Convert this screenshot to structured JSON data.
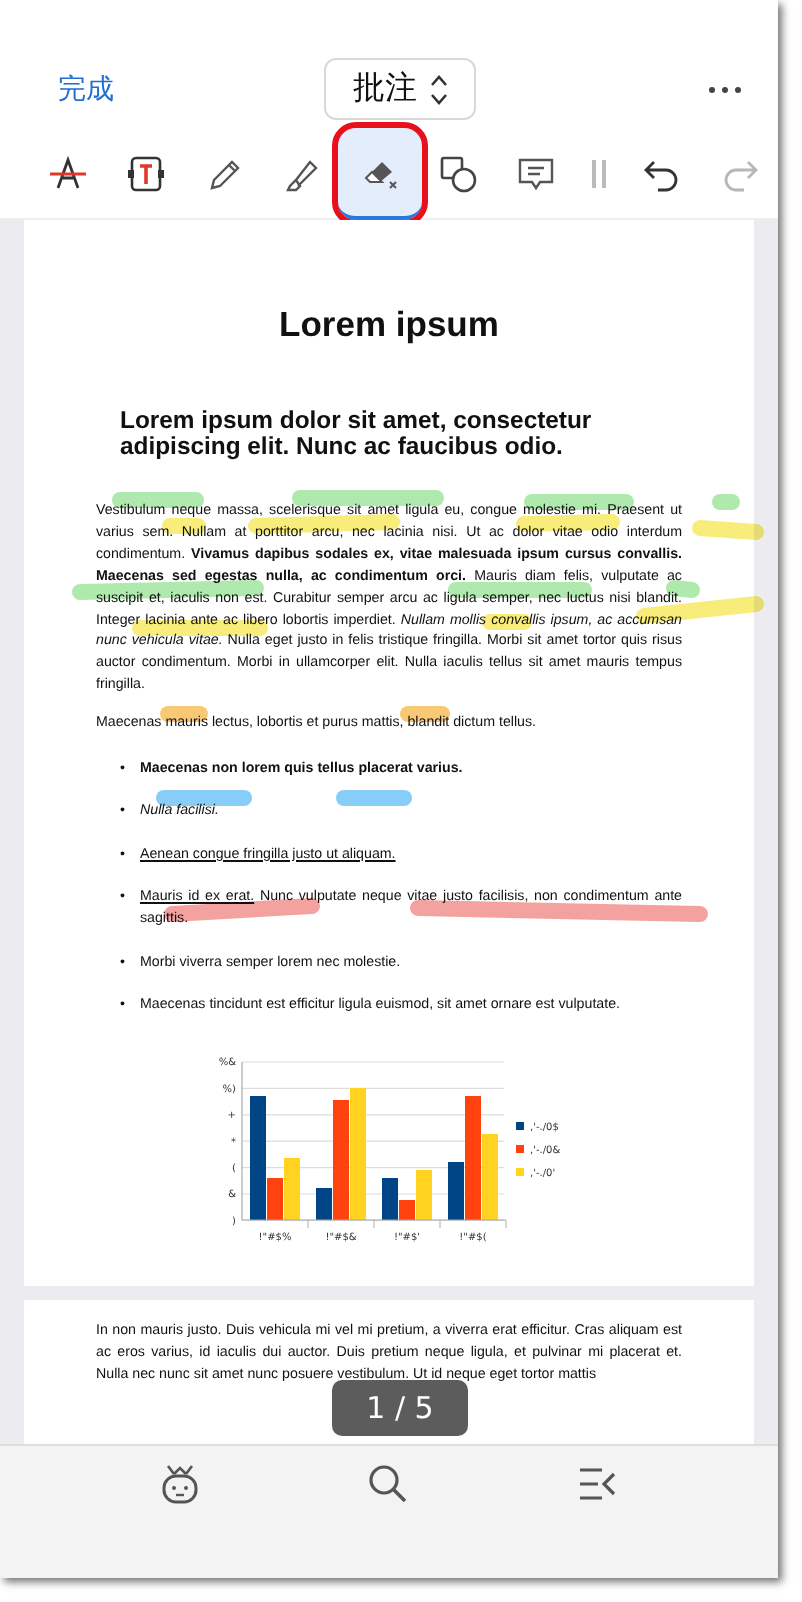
{
  "header": {
    "done": "完成",
    "mode": "批注"
  },
  "tools": [
    {
      "kind": "strikethrough",
      "selected": false
    },
    {
      "kind": "textbox",
      "selected": false
    },
    {
      "kind": "pencil",
      "selected": false
    },
    {
      "kind": "highlighter",
      "selected": false
    },
    {
      "kind": "eraser",
      "selected": true
    },
    {
      "kind": "shapes",
      "selected": false
    },
    {
      "kind": "comment",
      "selected": false
    },
    {
      "kind": "handle",
      "selected": false
    },
    {
      "kind": "undo",
      "disabled": false
    },
    {
      "kind": "redo",
      "disabled": true
    }
  ],
  "page1": {
    "title": "Lorem ipsum",
    "subtitle": "Lorem ipsum dolor sit amet, consectetur adipiscing elit. Nunc ac faucibus odio.",
    "paragraphs": [
      "Vestibulum neque massa, scelerisque sit amet ligula eu, congue molestie mi. Praesent ut varius sem. Nullam at porttitor arcu, nec lacinia nisi. Ut ac dolor vitae odio interdum condimentum. **Vivamus dapibus sodales ex, vitae malesuada ipsum cursus convallis. Maecenas sed egestas nulla, ac condimentum orci.** Mauris diam felis, vulputate ac suscipit et, iaculis non est. Curabitur semper arcu ac ligula semper, nec luctus nisi blandit. Integer lacinia ante ac libero lobortis imperdiet. *Nullam mollis convallis ipsum, ac accumsan nunc vehicula vitae.* Nulla eget justo in felis tristique fringilla. Morbi sit amet tortor quis risus auctor condimentum. Morbi in ullamcorper elit. Nulla iaculis tellus sit amet mauris tempus fringilla.",
      "Maecenas mauris lectus, lobortis et purus mattis, blandit dictum tellus."
    ],
    "list": [
      {
        "kind": "bold",
        "marker": "•",
        "text": "Maecenas non lorem quis tellus placerat varius."
      },
      {
        "kind": "italic",
        "marker": "•",
        "text": "Nulla facilisi."
      },
      {
        "kind": "underline",
        "marker": "•",
        "text": "Aenean congue fringilla justo ut aliquam."
      },
      {
        "kind": "lead-underline",
        "marker": "•",
        "underlined": "Mauris id ex erat.",
        "text": " Nunc vulputate neque vitae justo facilisis, non condimentum ante sagittis."
      },
      {
        "kind": "plain",
        "marker": "•",
        "text": "Morbi viverra semper lorem nec molestie."
      },
      {
        "kind": "plain",
        "marker": "•",
        "text": "Maecenas tincidunt est efficitur ligula euismod, sit amet ornare est vulputate."
      }
    ],
    "chart": {
      "y_tick_labels": [
        "%&",
        "%)",
        "+",
        "*",
        "(",
        "&",
        ")"
      ],
      "category_labels": [
        "!\"#$%",
        "!\"#$&",
        "!\"#$'",
        "!\"#$("
      ],
      "legend": [
        {
          "name": ",'-./0$",
          "color": "#004586"
        },
        {
          "name": ",'-./0&",
          "color": "#ff420e"
        },
        {
          "name": ",'-./0'",
          "color": "#ffd320"
        }
      ]
    }
  },
  "page2": {
    "text": "In non mauris justo. Duis vehicula mi vel mi pretium, a viverra erat efficitur. Cras aliquam est ac eros varius, id iaculis dui auctor. Duis pretium neque ligula, et pulvinar mi placerat et. Nulla nec nunc sit amet nunc posuere vestibulum. Ut id neque eget tortor mattis"
  },
  "page_indicator": "1 / 5"
}
